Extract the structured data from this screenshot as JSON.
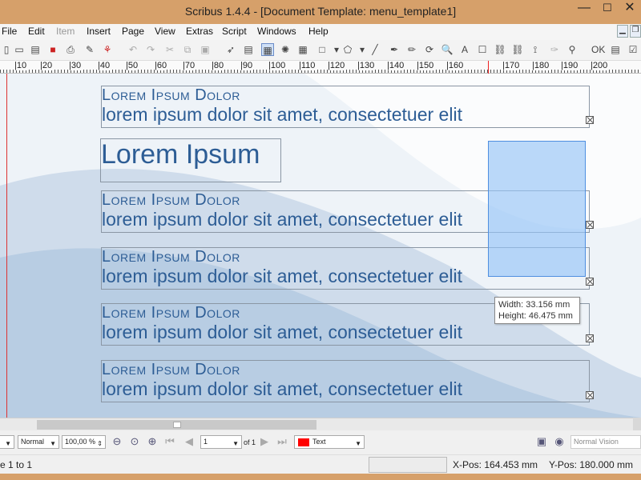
{
  "window": {
    "title": "Scribus 1.4.4 - [Document Template: menu_template1]"
  },
  "window_controls": {
    "minimize": "—",
    "maximize": "☐",
    "close": "✕"
  },
  "menubar": {
    "items": [
      {
        "label": "File",
        "enabled": true
      },
      {
        "label": "Edit",
        "enabled": true
      },
      {
        "label": "Item",
        "enabled": false
      },
      {
        "label": "Insert",
        "enabled": true
      },
      {
        "label": "Page",
        "enabled": true
      },
      {
        "label": "View",
        "enabled": true
      },
      {
        "label": "Extras",
        "enabled": true
      },
      {
        "label": "Script",
        "enabled": true
      },
      {
        "label": "Windows",
        "enabled": true
      },
      {
        "label": "Help",
        "enabled": true
      }
    ]
  },
  "ruler": {
    "labels": [
      "|10",
      "|20",
      "|30",
      "|40",
      "|50",
      "|60",
      "|70",
      "|80",
      "|90",
      "|100",
      "|110",
      "|120",
      "|130",
      "|140",
      "|150",
      "|160",
      "|170",
      "|180",
      "|190",
      "|200"
    ]
  },
  "canvas": {
    "heading": "Lorem Ipsum Dolor",
    "body": "lorem ipsum dolor sit amet, consectetuer elit",
    "big_title": "Lorem Ipsum",
    "tooltip": {
      "width": "Width: 33.156 mm",
      "height": "Height: 46.475 mm"
    }
  },
  "bottombar": {
    "image_preview_quality": "Normal",
    "zoom": "100,00 %",
    "page": "1",
    "page_of": "of 1",
    "layer": "Text",
    "layer_color": "#ff0000",
    "visual_appearance": "Normal Vision"
  },
  "statusbar": {
    "left": "e 1 to 1",
    "xpos": "X-Pos:   164.453 mm",
    "ypos": "Y-Pos:   180.000 mm"
  },
  "colors": {
    "accent_text": "#2d5d95",
    "selection": "#96c4f8",
    "titlebar": "#d6a06a"
  }
}
